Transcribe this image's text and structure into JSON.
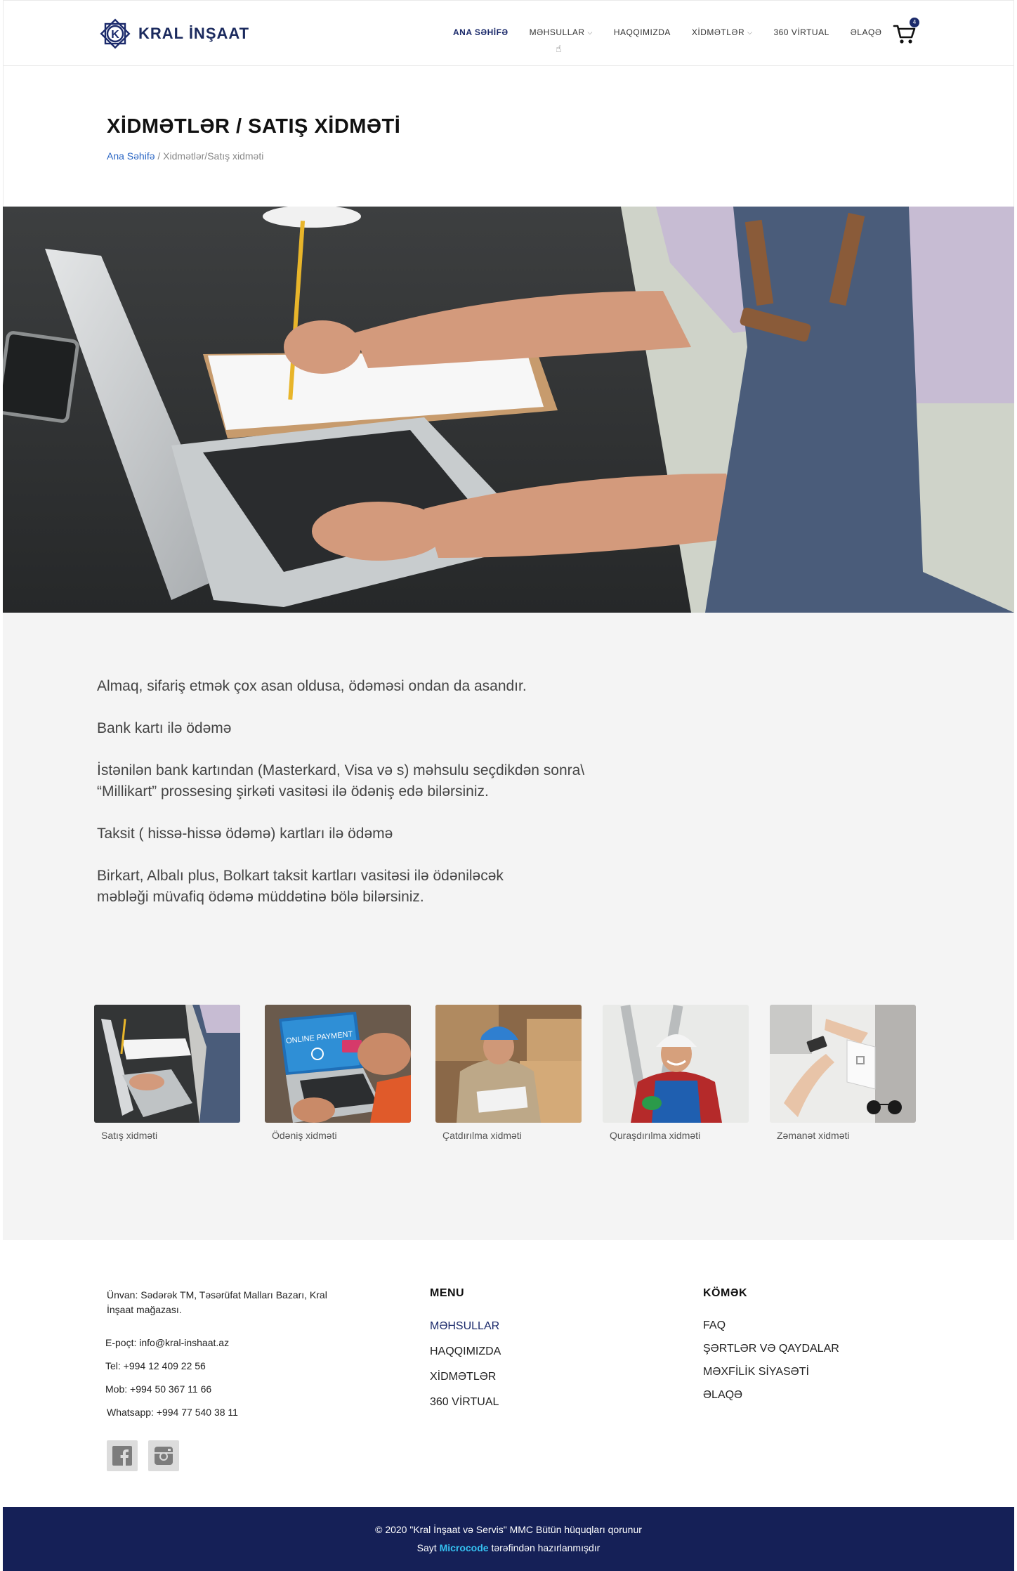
{
  "header": {
    "logo_text": "KRAL İNŞAAT",
    "nav": [
      {
        "label": "ANA SƏHİFƏ",
        "active": true,
        "dropdown": false
      },
      {
        "label": "MƏHSULLAR",
        "active": false,
        "dropdown": true
      },
      {
        "label": "HAQQIMIZDA",
        "active": false,
        "dropdown": false
      },
      {
        "label": "XİDMƏTLƏR",
        "active": false,
        "dropdown": true
      },
      {
        "label": "360 VİRTUAL",
        "active": false,
        "dropdown": false
      },
      {
        "label": "ƏLAQƏ",
        "active": false,
        "dropdown": false
      }
    ],
    "cart_count": "4"
  },
  "title_band": {
    "title": "XİDMƏTLƏR / SATIŞ XİDMƏTİ",
    "breadcrumb_home": "Ana Səhifə",
    "breadcrumb_rest": " / Xidmətlər/Satış xidməti"
  },
  "content": {
    "paragraphs": [
      "Almaq, sifariş etmək çox asan oldusa, ödəməsi ondan da asandır.",
      "Bank  kartı ilə ödəmə",
      "İstənilən bank  kartından (Masterkard, Visa və s)   məhsulu seçdikdən sonra\\ \n “Millikart” prossesing şirkəti  vasitəsi ilə  ödəniş edə bilərsiniz.",
      "Taksit ( hissə-hissə ödəmə) kartları ilə ödəmə",
      "Birkart, Albalı plus, Bolkart taksit kartları vasitəsi ilə  ödəniləcək \n məbləği müvafiq ödəmə müddətinə bölə bilərsiniz."
    ]
  },
  "services": [
    {
      "caption": "Satış xidməti",
      "icon": "laptop-photo"
    },
    {
      "caption": "Ödəniş xidməti",
      "icon": "online-payment-photo",
      "photo_text": "ONLINE PAYMENT"
    },
    {
      "caption": "Çatdırılma xidməti",
      "icon": "delivery-photo"
    },
    {
      "caption": "Quraşdırılma xidməti",
      "icon": "installer-photo"
    },
    {
      "caption": "Zəmanət xidməti",
      "icon": "warranty-photo"
    }
  ],
  "footer": {
    "address": "Ünvan:  Sədərək TM, Təsərüfat Malları Bazarı, Kral İnşaat mağazası.",
    "email": "E-poçt: info@kral-inshaat.az",
    "tel": "Tel: +994 12 409 22 56",
    "mob": "Mob: +994 50 367 11 66",
    "whatsapp": "Whatsapp: +994 77 540 38 11",
    "menu_title": "MENU",
    "menu_items": [
      "MƏHSULLAR",
      "HAQQIMIZDA",
      "XİDMƏTLƏR",
      "360 VİRTUAL"
    ],
    "help_title": "KÖMƏK",
    "help_items": [
      "FAQ",
      "ŞƏRTLƏR VƏ QAYDALAR",
      "MƏXFİLİK SİYASƏTİ",
      "ƏLAQƏ"
    ],
    "social": [
      "facebook-icon",
      "instagram-icon"
    ]
  },
  "bottom": {
    "copyright": "© 2020 \"Kral İnşaat və Servis\" MMC Bütün hüquqları qorunur",
    "credit_prefix": "Sayt ",
    "credit_brand": "Microcode",
    "credit_suffix": " tərəfindən hazırlanmışdır"
  },
  "colors": {
    "brand": "#1b2a6b",
    "footer_bar": "#152057",
    "accent_link": "#2a66c4",
    "microcode": "#35c0f0"
  }
}
